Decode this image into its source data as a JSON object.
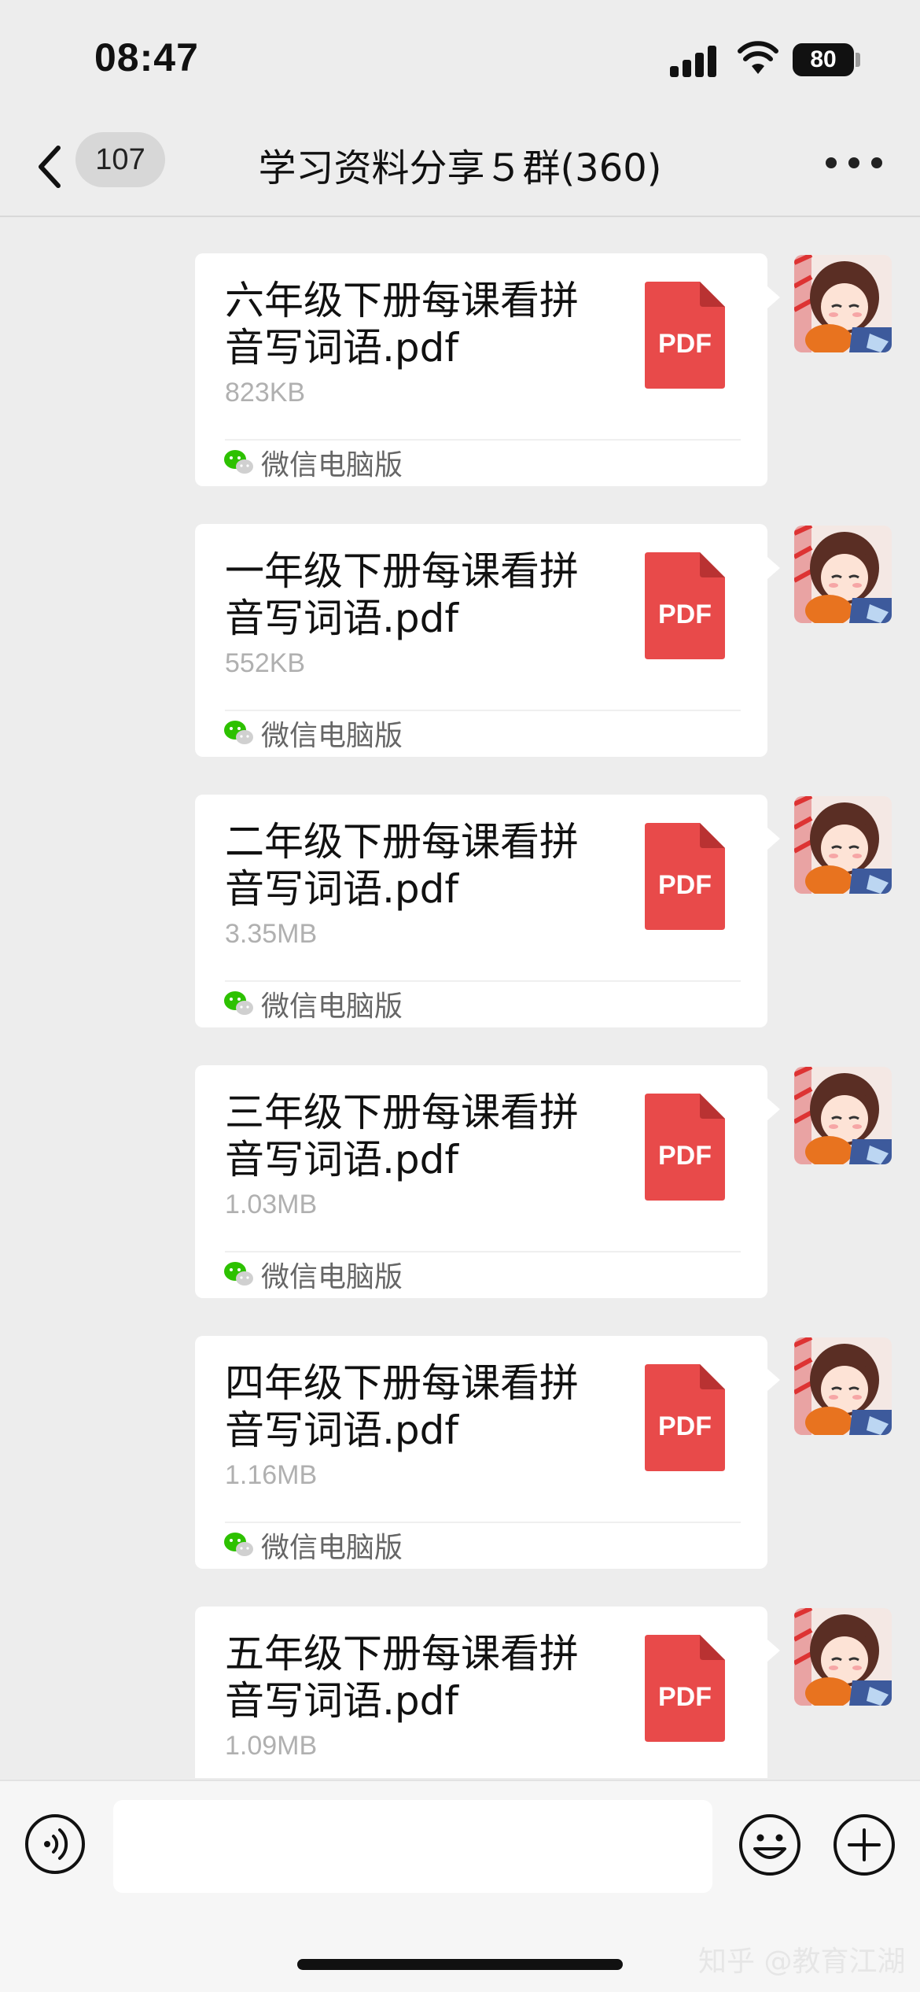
{
  "status_bar": {
    "time": "08:47",
    "battery": "80"
  },
  "nav": {
    "unread_count": "107",
    "title": "学习资料分享５群(360)"
  },
  "source_app": "微信电脑版",
  "file_type_label": "PDF",
  "colors": {
    "pdf_red": "#e84a4a",
    "bubble_bg": "#ffffff",
    "chat_bg": "#ededed",
    "wechat_green": "#2dc100"
  },
  "messages": [
    {
      "file_name": "六年级下册每课看拼音写词语.pdf",
      "file_size": "823KB"
    },
    {
      "file_name": "一年级下册每课看拼音写词语.pdf",
      "file_size": "552KB"
    },
    {
      "file_name": "二年级下册每课看拼音写词语.pdf",
      "file_size": "3.35MB"
    },
    {
      "file_name": "三年级下册每课看拼音写词语.pdf",
      "file_size": "1.03MB"
    },
    {
      "file_name": "四年级下册每课看拼音写词语.pdf",
      "file_size": "1.16MB"
    },
    {
      "file_name": "五年级下册每课看拼音写词语.pdf",
      "file_size": "1.09MB"
    }
  ],
  "input": {
    "value": ""
  },
  "icons": [
    "back-arrow-icon",
    "more-icon",
    "voice-icon",
    "emoji-icon",
    "plus-icon",
    "pdf-file-icon",
    "wechat-icon",
    "avatar"
  ],
  "watermark": "知乎 @教育江湖"
}
